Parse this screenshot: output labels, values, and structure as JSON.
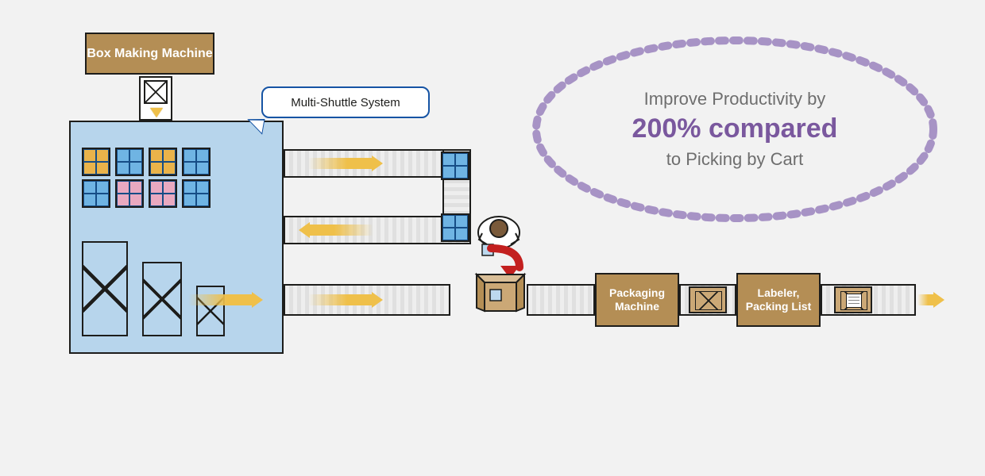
{
  "labels": {
    "box_making": "Box Making Machine",
    "multi_shuttle": "Multi-Shuttle System",
    "packaging": "Packaging Machine",
    "labeler": "Labeler, Packing List"
  },
  "badge": {
    "line1": "Improve Productivity by",
    "big": "200% compared",
    "line3": "to Picking by Cart"
  },
  "colors": {
    "tan": "#b48e55",
    "blue_panel": "#b7d5ec",
    "callout_border": "#1654a4",
    "purple": "#7a589e",
    "orange_bin": "#eab34a",
    "blue_bin": "#6fb4e3",
    "pink_bin": "#e9a9c0",
    "arrow": "#efc04a",
    "red": "#c3201f"
  },
  "icons": {
    "worker": "worker-top-view-icon",
    "red_arrow": "curved-red-arrow-icon",
    "open_carton": "open-carton-icon",
    "document": "document-icon"
  }
}
